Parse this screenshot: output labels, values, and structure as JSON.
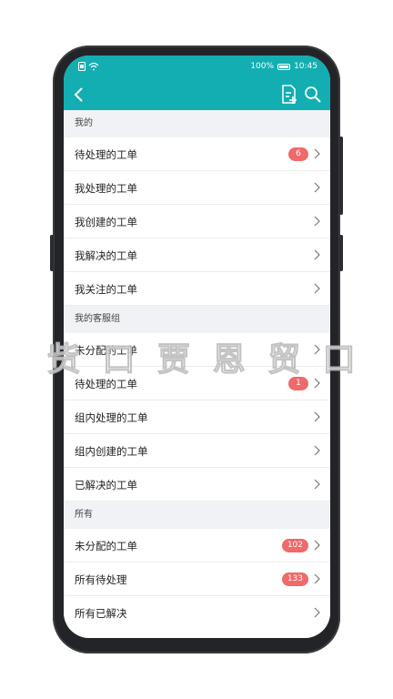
{
  "status": {
    "battery": "100%",
    "time": "10:45"
  },
  "sections": [
    {
      "title": "我的",
      "rows": [
        {
          "label": "待处理的工单",
          "badge": "6"
        },
        {
          "label": "我处理的工单",
          "badge": null
        },
        {
          "label": "我创建的工单",
          "badge": null
        },
        {
          "label": "我解决的工单",
          "badge": null
        },
        {
          "label": "我关注的工单",
          "badge": null
        }
      ]
    },
    {
      "title": "我的客服组",
      "rows": [
        {
          "label": "未分配的工单",
          "badge": null
        },
        {
          "label": "待处理的工单",
          "badge": "1"
        },
        {
          "label": "组内处理的工单",
          "badge": null
        },
        {
          "label": "组内创建的工单",
          "badge": null
        },
        {
          "label": "已解决的工单",
          "badge": null
        }
      ]
    },
    {
      "title": "所有",
      "rows": [
        {
          "label": "未分配的工单",
          "badge": "102"
        },
        {
          "label": "所有待处理",
          "badge": "133"
        },
        {
          "label": "所有已解决",
          "badge": null
        }
      ]
    }
  ],
  "overlay": {
    "text": "赀 口 贾 恩 贸 口"
  },
  "colors": {
    "accent": "#12aeb1",
    "badge": "#ef6a6a"
  }
}
